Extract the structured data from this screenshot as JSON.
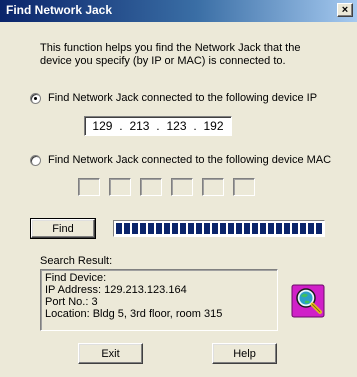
{
  "window": {
    "title": "Find Network Jack",
    "close_glyph": "×"
  },
  "description": {
    "line1": "This function helps you find the Network Jack that the",
    "line2": "device you specify (by IP or MAC) is connected to."
  },
  "option_ip": {
    "label": "Find Network Jack connected to the following device IP",
    "selected": true
  },
  "ip": {
    "oct1": "129",
    "oct2": "213",
    "oct3": "123",
    "oct4": "192",
    "sep": "."
  },
  "option_mac": {
    "label": "Find Network Jack connected to the following device MAC",
    "selected": false
  },
  "find_button": {
    "label": "Find"
  },
  "progress": {
    "value": 1.0,
    "color": "#0a246a"
  },
  "result": {
    "label": "Search Result:",
    "line1": "Find Device:",
    "line2": "IP Address: 129.213.123.164",
    "line3": "Port No.: 3",
    "line4": "Location: Bldg 5, 3rd floor, room 315",
    "icon": "network-search-icon"
  },
  "exit_button": {
    "label": "Exit"
  },
  "help_button": {
    "label": "Help"
  }
}
